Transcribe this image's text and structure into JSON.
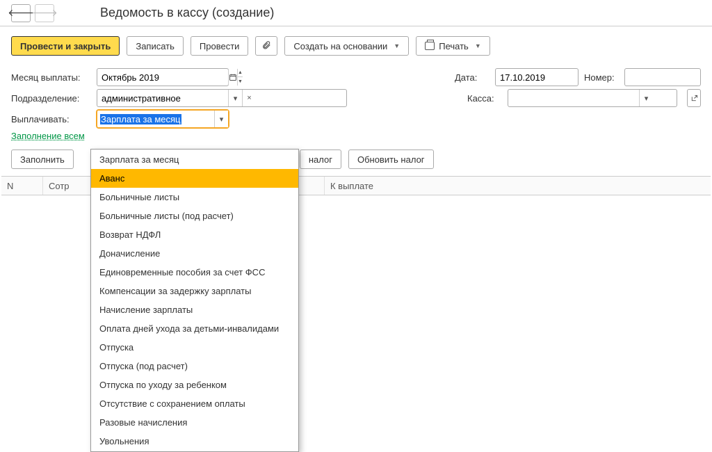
{
  "title": "Ведомость в кассу (создание)",
  "toolbar": {
    "post_close": "Провести и закрыть",
    "save": "Записать",
    "post": "Провести",
    "create_based": "Создать на основании",
    "print": "Печать"
  },
  "form": {
    "month_label": "Месяц выплаты:",
    "month_value": "Октябрь 2019",
    "date_label": "Дата:",
    "date_value": "17.10.2019",
    "number_label": "Номер:",
    "number_value": "",
    "dept_label": "Подразделение:",
    "dept_value": "административное",
    "cash_label": "Касса:",
    "cash_value": "",
    "pay_label": "Выплачивать:",
    "pay_value": "Зарплата за месяц",
    "fill_all_link": "Заполнение всем"
  },
  "actions": {
    "fill": "Заполнить",
    "tax": "налог",
    "update_tax": "Обновить налог"
  },
  "table": {
    "col_n": "N",
    "col_emp": "Сотр",
    "col_pay": "К выплате"
  },
  "dropdown": {
    "items": [
      "Зарплата за месяц",
      "Аванс",
      "Больничные листы",
      "Больничные листы (под расчет)",
      "Возврат НДФЛ",
      "Доначисление",
      "Единовременные пособия за счет ФСС",
      "Компенсации за задержку зарплаты",
      "Начисление зарплаты",
      "Оплата дней ухода за детьми-инвалидами",
      "Отпуска",
      "Отпуска (под расчет)",
      "Отпуска по уходу за ребенком",
      "Отсутствие с сохранением оплаты",
      "Разовые начисления",
      "Увольнения"
    ],
    "hover_index": 1
  }
}
